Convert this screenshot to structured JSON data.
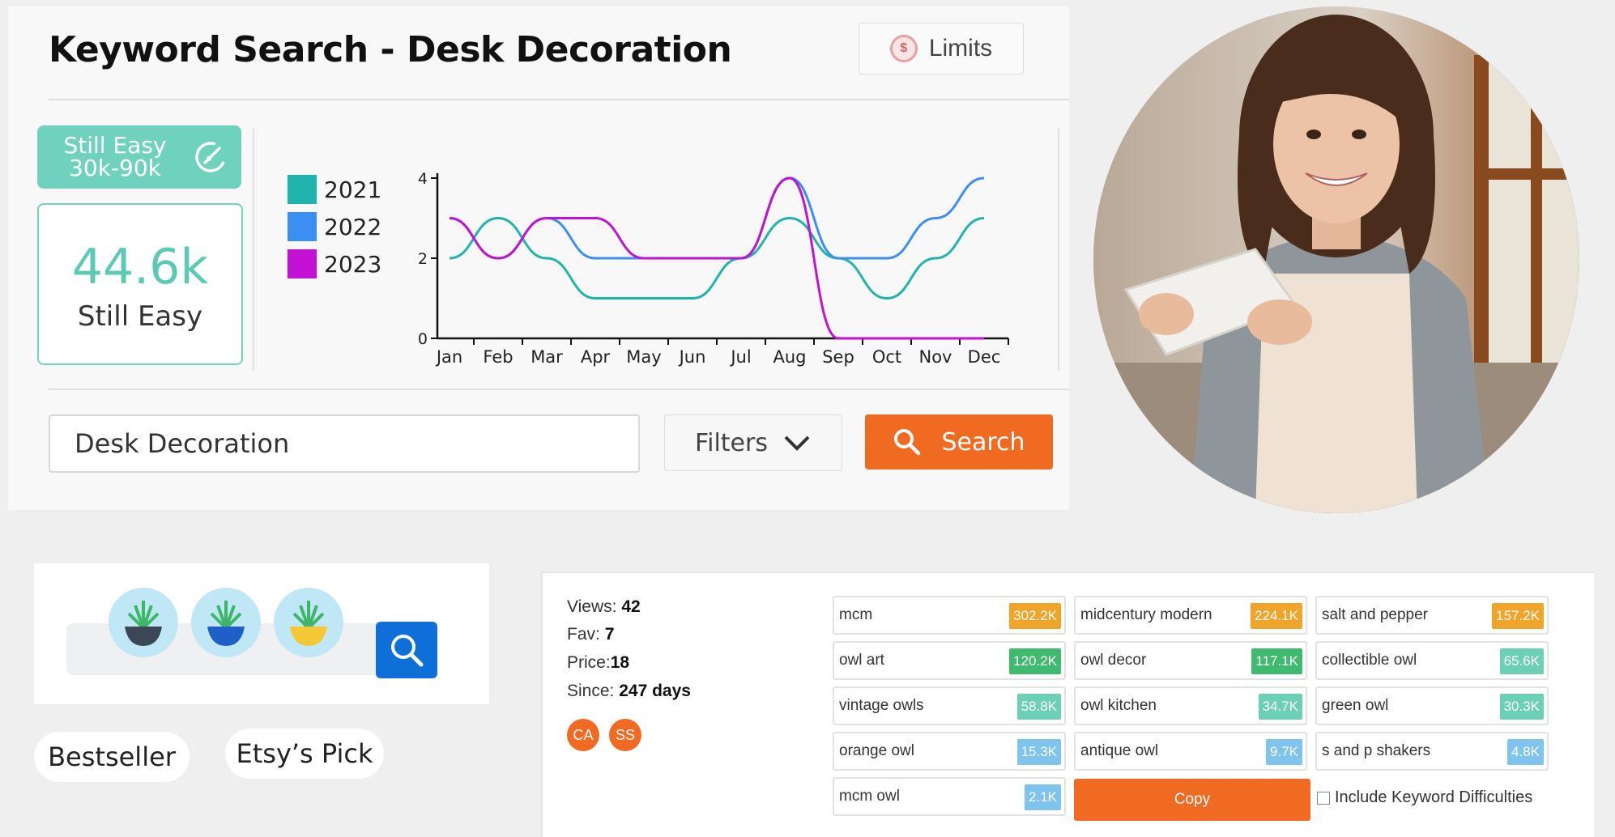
{
  "header": {
    "title": "Keyword Search - Desk Decoration",
    "limits_label": "Limits"
  },
  "difficulty": {
    "badge_line1": "Still Easy",
    "badge_line2": "30k-90k",
    "volume_value": "44.6k",
    "volume_label": "Still Easy"
  },
  "search": {
    "query": "Desk Decoration",
    "filters_label": "Filters",
    "search_label": "Search"
  },
  "chart_data": {
    "type": "line",
    "categories": [
      "Jan",
      "Feb",
      "Mar",
      "Apr",
      "May",
      "Jun",
      "Jul",
      "Aug",
      "Sep",
      "Oct",
      "Nov",
      "Dec"
    ],
    "series": [
      {
        "name": "2021",
        "color": "#1fb5ac",
        "values": [
          2,
          3,
          2,
          1,
          1,
          1,
          2,
          3,
          2,
          1,
          2,
          3
        ]
      },
      {
        "name": "2022",
        "color": "#3b8ff2",
        "values": [
          3,
          2,
          3,
          2,
          2,
          2,
          2,
          4,
          2,
          2,
          3,
          4
        ]
      },
      {
        "name": "2023",
        "color": "#c311d6",
        "values": [
          3,
          2,
          3,
          3,
          2,
          2,
          2,
          4,
          0,
          0,
          0,
          0
        ]
      }
    ],
    "ylim": [
      0,
      4
    ],
    "yticks": [
      "0",
      "2",
      "4"
    ],
    "legend_position": "left"
  },
  "pills": {
    "bestseller": "Bestseller",
    "etsy_pick": "Etsy’s Pick"
  },
  "listing": {
    "views_label": "Views:",
    "views_value": "42",
    "fav_label": "Fav:",
    "fav_value": "7",
    "price_label": "Price:",
    "price_value": "18",
    "since_label": "Since:",
    "since_value": "247 days",
    "badges": [
      "CA",
      "SS"
    ],
    "tags": [
      {
        "label": "mcm",
        "count": "302.2K",
        "color": "#f0a42a"
      },
      {
        "label": "midcentury modern",
        "count": "224.1K",
        "color": "#f0a42a"
      },
      {
        "label": "salt and pepper",
        "count": "157.2K",
        "color": "#f0a42a"
      },
      {
        "label": "owl art",
        "count": "120.2K",
        "color": "#3fba6e"
      },
      {
        "label": "owl decor",
        "count": "117.1K",
        "color": "#3fba6e"
      },
      {
        "label": "collectible owl",
        "count": "65.6K",
        "color": "#6cd0b7"
      },
      {
        "label": "vintage owls",
        "count": "58.8K",
        "color": "#6cd0b7"
      },
      {
        "label": "owl kitchen",
        "count": "34.7K",
        "color": "#6cd0b7"
      },
      {
        "label": "green owl",
        "count": "30.3K",
        "color": "#6cd0b7"
      },
      {
        "label": "orange owl",
        "count": "15.3K",
        "color": "#7ec4ef"
      },
      {
        "label": "antique owl",
        "count": "9.7K",
        "color": "#7ec4ef"
      },
      {
        "label": "s and p shakers",
        "count": "4.8K",
        "color": "#7ec4ef"
      },
      {
        "label": "mcm owl",
        "count": "2.1K",
        "color": "#7ec4ef"
      }
    ],
    "copy_label": "Copy",
    "include_kd_label": "Include Keyword Difficulties"
  }
}
